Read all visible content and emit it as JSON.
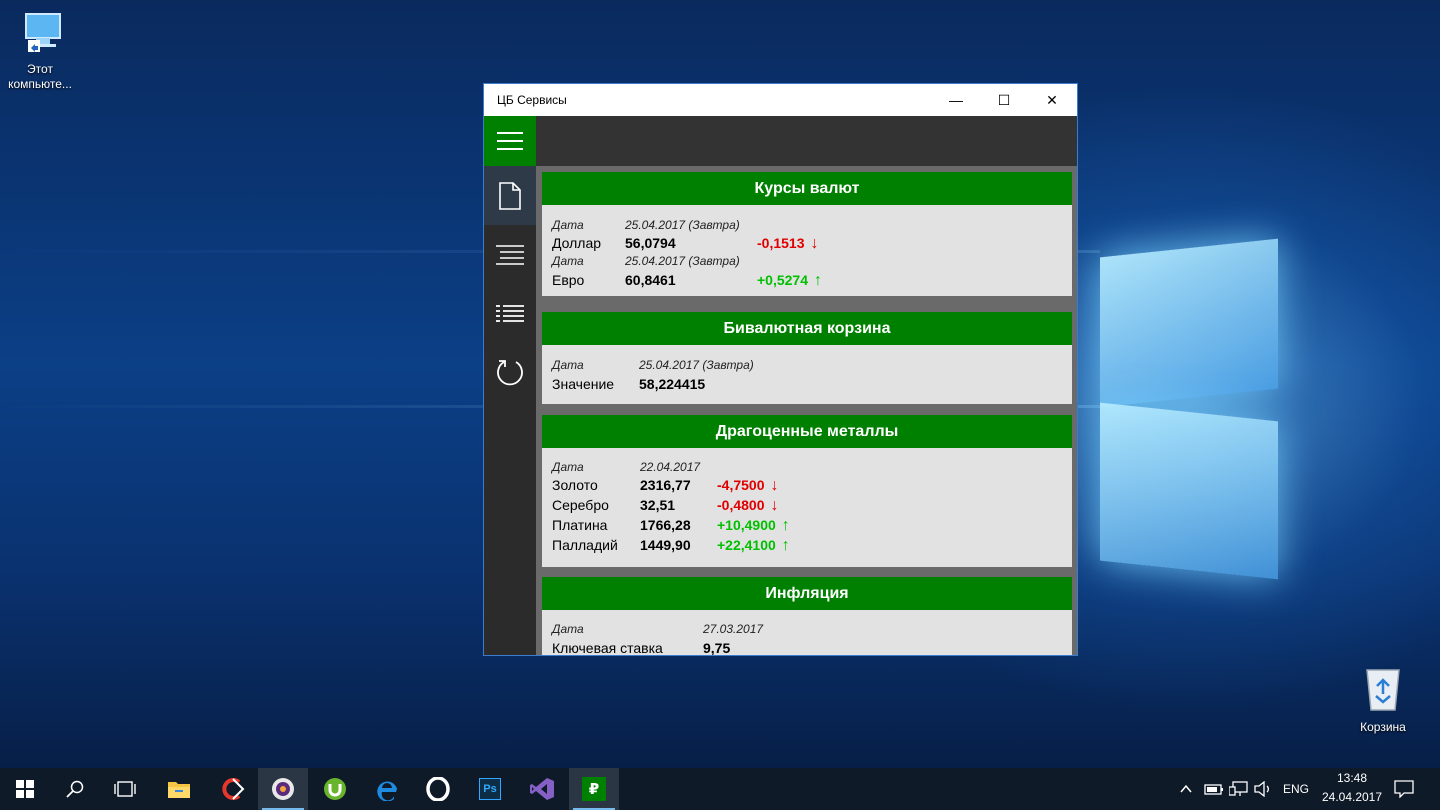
{
  "desktop": {
    "icons": [
      {
        "label": "Этот компьюте..."
      },
      {
        "label": "Корзина"
      }
    ]
  },
  "window": {
    "title": "ЦБ Сервисы",
    "controls": {
      "minimize": "—",
      "maximize": "☐",
      "close": "✕"
    }
  },
  "nav": [
    {
      "icon": "document-icon",
      "active": true
    },
    {
      "icon": "list-icon",
      "active": false
    },
    {
      "icon": "detailed-list-icon",
      "active": false
    },
    {
      "icon": "refresh-icon",
      "active": false
    }
  ],
  "currency": {
    "title": "Курсы валют",
    "rows": [
      {
        "date_label": "Дата",
        "date": "25.04.2017 (Завтра)",
        "name": "Доллар",
        "value": "56,0794",
        "change": "-0,1513",
        "direction": "down"
      },
      {
        "date_label": "Дата",
        "date": "25.04.2017 (Завтра)",
        "name": "Евро",
        "value": "60,8461",
        "change": "+0,5274",
        "direction": "up"
      }
    ]
  },
  "basket": {
    "title": "Бивалютная корзина",
    "date_label": "Дата",
    "date": "25.04.2017 (Завтра)",
    "name": "Значение",
    "value": "58,224415"
  },
  "metals": {
    "title": "Драгоценные металлы",
    "date_label": "Дата",
    "date": "22.04.2017",
    "rows": [
      {
        "name": "Золото",
        "value": "2316,77",
        "change": "-4,7500",
        "direction": "down"
      },
      {
        "name": "Серебро",
        "value": "32,51",
        "change": "-0,4800",
        "direction": "down"
      },
      {
        "name": "Платина",
        "value": "1766,28",
        "change": "+10,4900",
        "direction": "up"
      },
      {
        "name": "Палладий",
        "value": "1449,90",
        "change": "+22,4100",
        "direction": "up"
      }
    ]
  },
  "inflation": {
    "title": "Инфляция",
    "date_label": "Дата",
    "date": "27.03.2017",
    "name": "Ключевая ставка",
    "value": "9,75"
  },
  "arrows": {
    "up": "↑",
    "down": "↓"
  },
  "taskbar": {
    "items": [
      "start-icon",
      "search-icon",
      "task-view-icon",
      "file-explorer-icon",
      "ccleaner-icon",
      "media-player-icon",
      "utorrent-icon",
      "edge-icon",
      "opera-icon",
      "photoshop-icon",
      "visual-studio-icon",
      "cb-services-icon"
    ],
    "photoshop_label": "Ps",
    "app_label": "₽",
    "lang": "ENG",
    "time": "13:48",
    "date": "24.04.2017"
  },
  "colors": {
    "accent_green": "#008000",
    "negative": "#e00000",
    "positive": "#00c000"
  }
}
